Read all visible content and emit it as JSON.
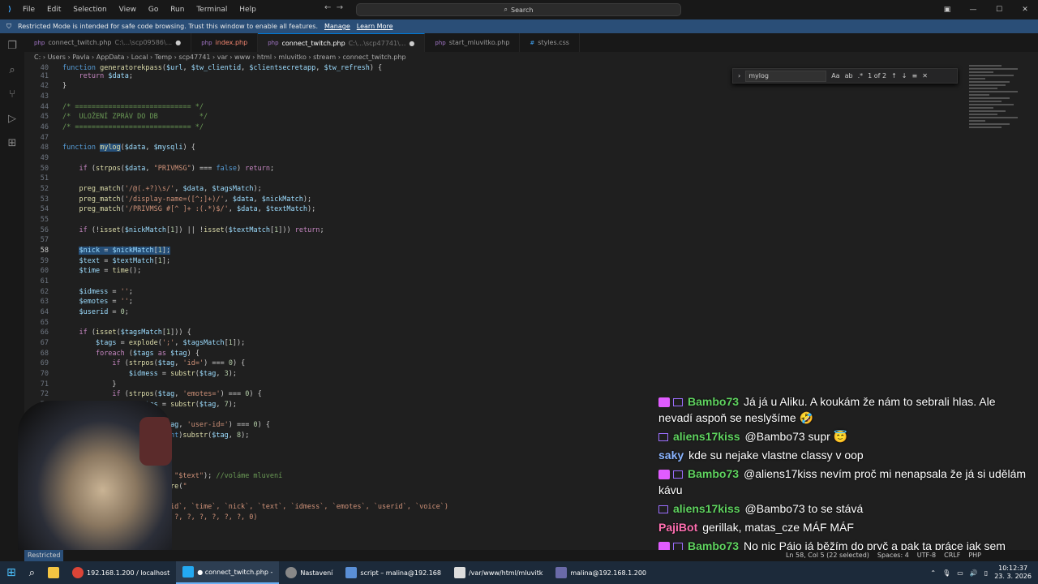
{
  "titlebar": {
    "menu": [
      "File",
      "Edit",
      "Selection",
      "View",
      "Go",
      "Run",
      "Terminal",
      "Help"
    ],
    "search": "Search"
  },
  "banner": {
    "text": "Restricted Mode is intended for safe code browsing. Trust this window to enable all features.",
    "manage": "Manage",
    "learn": "Learn More"
  },
  "tabs": [
    {
      "name": "connect_twitch.php",
      "path": "C:\\...\\scp09586\\...",
      "dirty": "●"
    },
    {
      "name": "index.php",
      "path": "",
      "dirty": ""
    },
    {
      "name": "connect_twitch.php",
      "path": "C:\\...\\scp47741\\...",
      "dirty": "●"
    },
    {
      "name": "start_mluvitko.php",
      "path": "",
      "dirty": ""
    },
    {
      "name": "styles.css",
      "path": "",
      "dirty": ""
    }
  ],
  "breadcrumb": "C: › Users › Pavla › AppData › Local › Temp › scp47741 › var › www › html › mluvitko › stream › connect_twitch.php",
  "find": {
    "query": "mylog",
    "result": "1 of 2"
  },
  "chat": [
    {
      "nick": "Bambo73",
      "color": "#5fd35f",
      "text": "Já já u Aliku. A koukám že nám to sebrali hlas. Ale nevadí aspoň se neslyšíme 🤣",
      "badges": 2
    },
    {
      "nick": "aliens17kiss",
      "color": "#5fd35f",
      "text": "@Bambo73 supr 😇",
      "badges": 1
    },
    {
      "nick": "saky",
      "color": "#8ab4ff",
      "text": "kde su nejake vlastne classy v oop",
      "badges": 0
    },
    {
      "nick": "Bambo73",
      "color": "#5fd35f",
      "text": "@aliens17kiss nevím proč mi nenapsala že já si udělám kávu",
      "badges": 2
    },
    {
      "nick": "aliens17kiss",
      "color": "#5fd35f",
      "text": "@Bambo73 to se stává",
      "badges": 1
    },
    {
      "nick": "PajiBot",
      "color": "#ff6fb0",
      "text": "gerillak, matas_cze MÁF MÁF",
      "badges": 0
    },
    {
      "nick": "Bambo73",
      "color": "#5fd35f",
      "text": "No nic Pájo já běžím do pryč a pak ta práce jak sem psal. Tak zatím čaves",
      "badges": 2
    }
  ],
  "status": {
    "restricted": "Restricted",
    "pos": "Ln 58, Col 5 (22 selected)",
    "spaces": "Spaces: 4",
    "enc": "UTF-8",
    "eol": "CRLF",
    "lang": "PHP"
  },
  "taskbar": [
    {
      "label": "192.168.1.200 / localhost"
    },
    {
      "label": "● connect_twitch.php -"
    },
    {
      "label": "Nastavení"
    },
    {
      "label": "script – malina@192.168"
    },
    {
      "label": "/var/www/html/mluvitk"
    },
    {
      "label": "malina@192.168.1.200"
    }
  ],
  "clock": {
    "time": "10:12:37",
    "date": "23. 3. 2026"
  }
}
